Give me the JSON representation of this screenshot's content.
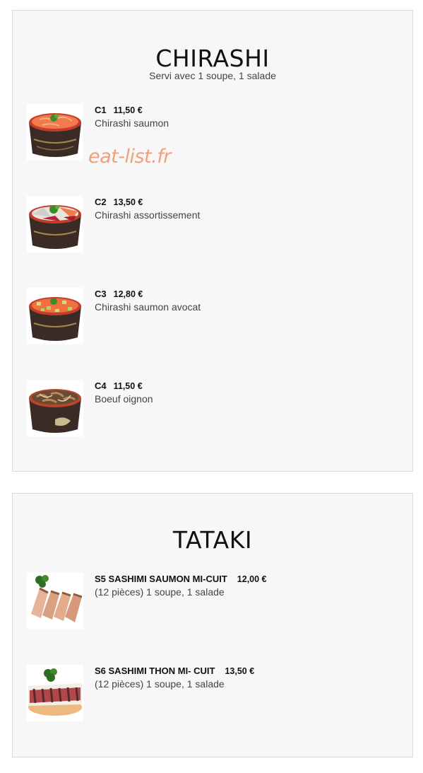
{
  "chirashi": {
    "title": "CHIRASHI",
    "subtitle": "Servi avec 1 soupe, 1 salade",
    "items": [
      {
        "code": "C1",
        "price": "11,50 €",
        "name": "Chirashi saumon",
        "image_icon": "chirashi-salmon-bowl-icon"
      },
      {
        "code": "C2",
        "price": "13,50 €",
        "name": "Chirashi assortissement",
        "image_icon": "chirashi-assorted-bowl-icon"
      },
      {
        "code": "C3",
        "price": "12,80 €",
        "name": "Chirashi saumon avocat",
        "image_icon": "chirashi-salmon-avocado-bowl-icon"
      },
      {
        "code": "C4",
        "price": "11,50 €",
        "name": "Boeuf oignon",
        "image_icon": "beef-onion-bowl-icon"
      }
    ]
  },
  "watermark": "eat-list.fr",
  "tataki": {
    "title": "TATAKI",
    "items": [
      {
        "code": "S5 SASHIMI SAUMON MI-CUIT",
        "price": "12,00 €",
        "desc": "(12 pièces) 1 soupe, 1 salade",
        "image_icon": "seared-salmon-sashimi-icon"
      },
      {
        "code": "S6 SASHIMI THON MI- CUIT",
        "price": "13,50 €",
        "desc": "(12 pièces) 1 soupe, 1 salade",
        "image_icon": "seared-tuna-sashimi-icon"
      }
    ]
  },
  "colors": {
    "card_background": "#f7f7f7",
    "card_border": "#dadada",
    "watermark": "#f2a07a",
    "text_primary": "#111111",
    "text_secondary": "#444444"
  }
}
